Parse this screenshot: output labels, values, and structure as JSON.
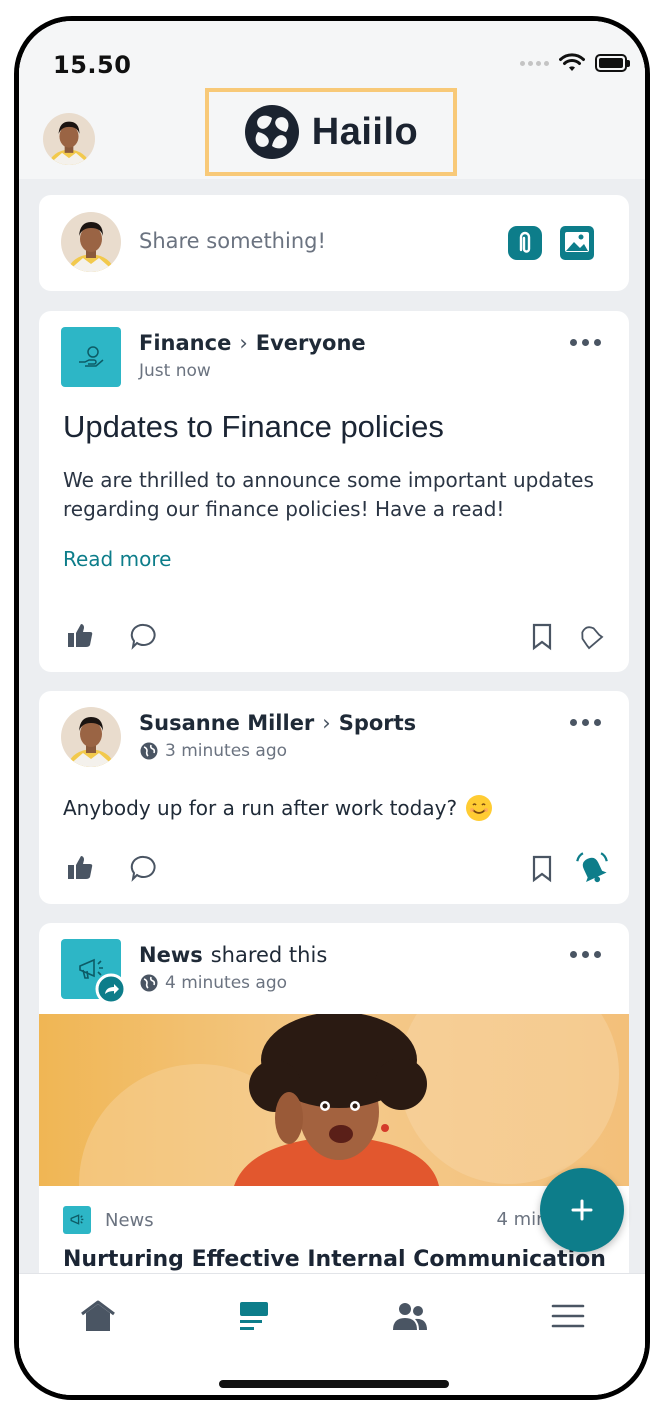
{
  "status_bar": {
    "time": "15.50"
  },
  "header": {
    "brand": "Haiilo"
  },
  "composer": {
    "placeholder": "Share something!"
  },
  "posts": [
    {
      "author": "Finance",
      "target": "Everyone",
      "time": "Just now",
      "title": "Updates to Finance policies",
      "body": "We are thrilled to announce some important updates regarding our finance policies! Have a read!",
      "read_more": "Read more"
    },
    {
      "author": "Susanne Miller",
      "target": "Sports",
      "time": "3 minutes ago",
      "body": "Anybody up for a run after work today?"
    },
    {
      "author": "News",
      "shared_label": "shared this",
      "time": "4 minutes ago",
      "source": "News",
      "age_clipped": "4 minu",
      "title": "Nurturing Effective Internal Communication"
    }
  ],
  "colors": {
    "accent": "#0d7d8a",
    "teal_badge": "#2db6c6",
    "feed_bg": "#eceef1",
    "logo_highlight": "#f8c978"
  },
  "icons": [
    "home-icon",
    "feed-icon",
    "people-icon",
    "menu-icon",
    "attachment-icon",
    "image-icon",
    "like-icon",
    "comment-icon",
    "bookmark-icon",
    "bell-icon",
    "more-icon",
    "plus-icon",
    "globe-icon"
  ]
}
